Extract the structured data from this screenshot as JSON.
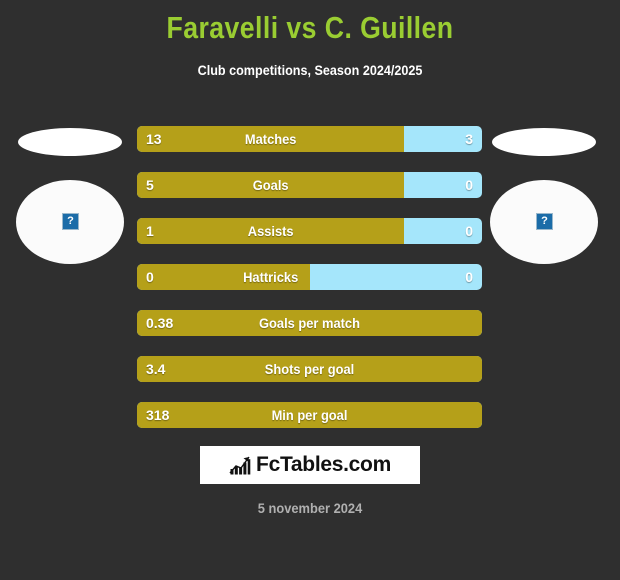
{
  "header": {
    "title": "Faravelli vs C. Guillen",
    "subtitle": "Club competitions, Season 2024/2025",
    "title_color": "#9acd32"
  },
  "players": {
    "home": {
      "avatar_placeholder": "?",
      "shirt_placeholder": ""
    },
    "away": {
      "avatar_placeholder": "?",
      "shirt_placeholder": ""
    }
  },
  "colors": {
    "background": "#2f2f2f",
    "home_bar": "#b5a019",
    "away_bar": "#a5e6fb",
    "accent_green": "#9acd32",
    "logo_background": "#ffffff",
    "date_text": "#b0b0b0"
  },
  "stats": [
    {
      "label": "Matches",
      "home": "13",
      "away": "3",
      "home_pct": 77.5,
      "has_away": true
    },
    {
      "label": "Goals",
      "home": "5",
      "away": "0",
      "home_pct": 77.5,
      "has_away": true
    },
    {
      "label": "Assists",
      "home": "1",
      "away": "0",
      "home_pct": 77.5,
      "has_away": true
    },
    {
      "label": "Hattricks",
      "home": "0",
      "away": "0",
      "home_pct": 50,
      "has_away": true
    },
    {
      "label": "Goals per match",
      "home": "0.38",
      "away": "",
      "home_pct": 100,
      "has_away": false
    },
    {
      "label": "Shots per goal",
      "home": "3.4",
      "away": "",
      "home_pct": 100,
      "has_away": false
    },
    {
      "label": "Min per goal",
      "home": "318",
      "away": "",
      "home_pct": 100,
      "has_away": false
    }
  ],
  "footer": {
    "logo_text": "FcTables.com",
    "logo_icon": "bar-chart-icon",
    "date": "5 november 2024"
  }
}
